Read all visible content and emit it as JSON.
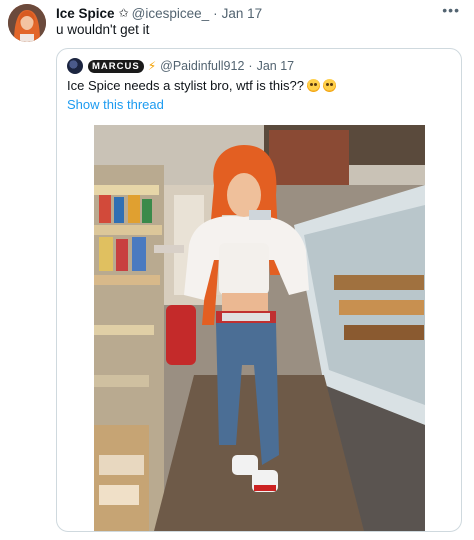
{
  "tweet": {
    "author_name": "Ice Spice",
    "author_handle": "@icespicee_",
    "separator": "·",
    "date": "Jan 17",
    "text": "u wouldn't get it",
    "badge_icon": "star-icon",
    "more_icon": "more-icon"
  },
  "quoted": {
    "author_name": "MARCUS",
    "badge_icon": "lightning-icon",
    "author_handle": "@Paidinfull912",
    "separator": "·",
    "date": "Jan 17",
    "text": "Ice Spice needs a stylist bro, wtf is this??",
    "emojis": [
      "grimacing-face-emoji",
      "grimacing-face-emoji"
    ],
    "show_thread_label": "Show this thread",
    "photo_description_icon": "photo-image"
  },
  "colors": {
    "link": "#1d9bf0",
    "secondary_text": "#536471",
    "border": "#cfd9de",
    "accent_bolt": "#f4a000"
  }
}
